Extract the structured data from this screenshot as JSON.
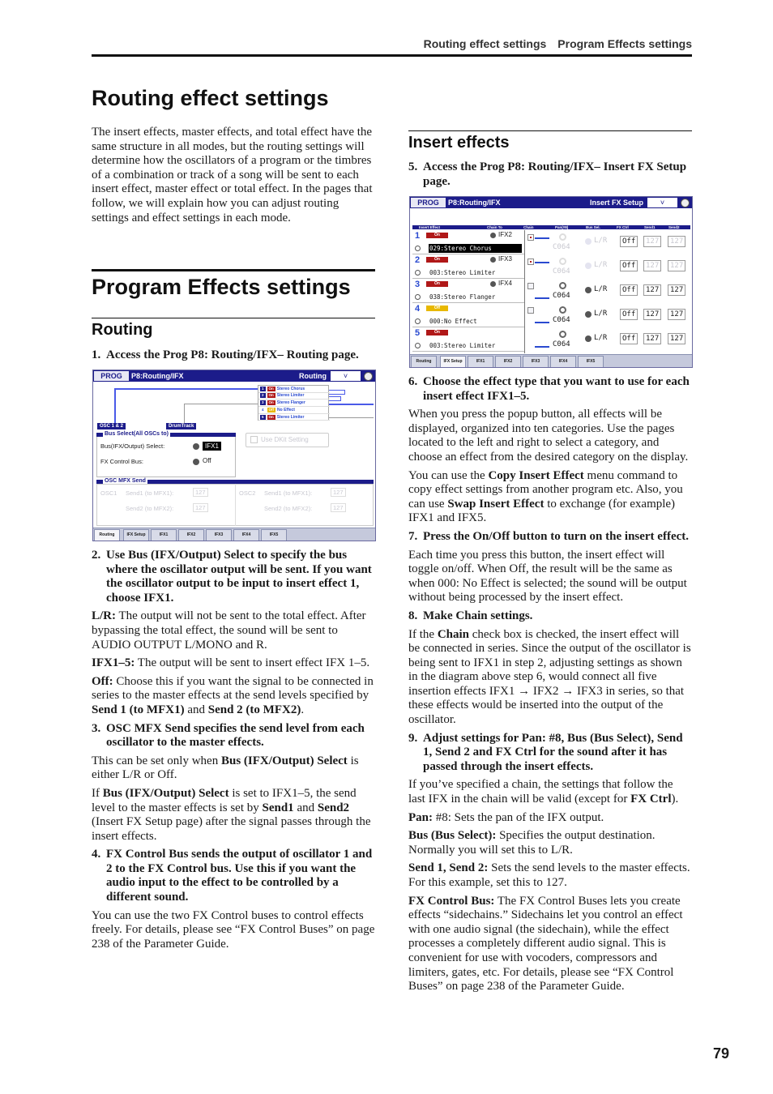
{
  "running_head": {
    "left": "Routing effect settings",
    "right": "Program Effects settings"
  },
  "page_number": "79",
  "sec1": {
    "title": "Routing effect settings",
    "intro": [
      {
        "t": "The insert effects, master effects, and total effect have the same structure in all modes, but the routing settings will determine how the oscillators of a program or the timbres of a combination or track of a song will be sent to each insert effect, master effect or total effect. In the pages that follow, we will explain how you can adjust routing settings and effect settings in each mode."
      }
    ]
  },
  "sec2": {
    "title": "Program Effects settings",
    "sub": "Routing"
  },
  "left_before": [
    {
      "type": "step",
      "num": "1.",
      "runs": [
        {
          "t": "Access the Prog P8: Routing/IFX– Routing page."
        }
      ]
    }
  ],
  "left_after": [
    {
      "type": "step",
      "num": "2.",
      "runs": [
        {
          "t": "Use Bus (IFX/Output) Select to specify the bus where the oscillator output will be sent. If you want the oscillator output to be input to insert effect 1, choose IFX1."
        }
      ]
    },
    {
      "type": "p",
      "runs": [
        {
          "t": "L/R:",
          "b": true
        },
        {
          "t": " The output will not be sent to the total effect. After bypassing the total effect, the sound will be sent to AUDIO OUTPUT L/MONO and R."
        }
      ]
    },
    {
      "type": "p",
      "runs": [
        {
          "t": "IFX1–5:",
          "b": true
        },
        {
          "t": " The output will be sent to insert effect IFX 1–5."
        }
      ]
    },
    {
      "type": "p",
      "runs": [
        {
          "t": "Off:",
          "b": true
        },
        {
          "t": " Choose this if you want the signal to be connected in series to the master effects at the send levels specified by "
        },
        {
          "t": "Send 1 (to MFX1)",
          "b": true
        },
        {
          "t": " and "
        },
        {
          "t": "Send 2 (to MFX2)",
          "b": true
        },
        {
          "t": "."
        }
      ]
    },
    {
      "type": "step",
      "num": "3.",
      "runs": [
        {
          "t": "OSC MFX Send specifies the send level from each oscillator to the master effects."
        }
      ]
    },
    {
      "type": "p",
      "runs": [
        {
          "t": "This can be set only when "
        },
        {
          "t": "Bus (IFX/Output) Select",
          "b": true
        },
        {
          "t": " is either L/R or Off."
        }
      ]
    },
    {
      "type": "p",
      "runs": [
        {
          "t": "If "
        },
        {
          "t": "Bus (IFX/Output) Select",
          "b": true
        },
        {
          "t": " is set to IFX1–5, the send level to the master effects is set by "
        },
        {
          "t": "Send1",
          "b": true
        },
        {
          "t": " and "
        },
        {
          "t": "Send2",
          "b": true
        },
        {
          "t": " (Insert FX Setup page) after the signal passes through the insert effects."
        }
      ]
    },
    {
      "type": "step",
      "num": "4.",
      "runs": [
        {
          "t": "FX Control Bus sends the output of oscillator 1 and 2 to the FX Control bus. Use this if you want the audio input to the effect to be controlled by a different sound."
        }
      ]
    },
    {
      "type": "p",
      "runs": [
        {
          "t": "You can use the two FX Control buses to control effects freely. For details, please see “FX Control Buses” on page 238 of the Parameter Guide."
        }
      ]
    }
  ],
  "sec3": {
    "title": "Insert effects"
  },
  "right_before": [
    {
      "type": "step",
      "num": "5.",
      "runs": [
        {
          "t": "Access the Prog P8: Routing/IFX– Insert FX Setup page."
        }
      ]
    }
  ],
  "right_after": [
    {
      "type": "step",
      "num": "6.",
      "runs": [
        {
          "t": "Choose the effect type that you want to use for each insert effect IFX1–5."
        }
      ]
    },
    {
      "type": "p",
      "runs": [
        {
          "t": "When you press the popup button, all effects will be displayed, organized into ten categories. Use the pages located to the left and right to select a category, and choose an effect from the desired category on the display."
        }
      ]
    },
    {
      "type": "p",
      "runs": [
        {
          "t": "You can use the "
        },
        {
          "t": "Copy Insert Effect",
          "b": true
        },
        {
          "t": " menu command to copy effect settings from another program etc. Also, you can use "
        },
        {
          "t": "Swap Insert Effect",
          "b": true
        },
        {
          "t": " to exchange (for example) IFX1 and IFX5."
        }
      ]
    },
    {
      "type": "step",
      "num": "7.",
      "runs": [
        {
          "t": "Press the On/Off button to turn on the insert effect."
        }
      ]
    },
    {
      "type": "p",
      "runs": [
        {
          "t": "Each time you press this button, the insert effect will toggle on/off. When Off, the result will be the same as when 000: No Effect is selected; the sound will be output without being processed by the insert effect."
        }
      ]
    },
    {
      "type": "step",
      "num": "8.",
      "runs": [
        {
          "t": "Make Chain settings."
        }
      ]
    },
    {
      "type": "p",
      "runs": [
        {
          "t": "If the "
        },
        {
          "t": "Chain",
          "b": true
        },
        {
          "t": " check box is checked, the insert effect will be connected in series. Since the output of the oscillator is being sent to IFX1 in step 2, adjusting settings as shown in the diagram above step 6, would connect all five insertion effects IFX1 → IFX2 → IFX3 in series, so that these effects would be inserted into the output of the oscillator."
        }
      ]
    },
    {
      "type": "step",
      "num": "9.",
      "runs": [
        {
          "t": "Adjust settings for Pan: #8, Bus (Bus Select), Send 1, Send 2 and FX Ctrl for the sound after it has passed through the insert effects."
        }
      ]
    },
    {
      "type": "p",
      "runs": [
        {
          "t": "If you’ve specified a chain, the settings that follow the last IFX in the chain will be valid (except for "
        },
        {
          "t": "FX Ctrl",
          "b": true
        },
        {
          "t": ")."
        }
      ]
    },
    {
      "type": "p",
      "runs": [
        {
          "t": "Pan:",
          "b": true
        },
        {
          "t": " #8: Sets the pan of the IFX output."
        }
      ]
    },
    {
      "type": "p",
      "runs": [
        {
          "t": "Bus (Bus Select):",
          "b": true
        },
        {
          "t": " Specifies the output destination. Normally you will set this to L/R."
        }
      ]
    },
    {
      "type": "p",
      "runs": [
        {
          "t": "Send 1, Send 2:",
          "b": true
        },
        {
          "t": " Sets the send levels to the master effects. For this example, set this to 127."
        }
      ]
    },
    {
      "type": "p",
      "runs": [
        {
          "t": "FX Control Bus:",
          "b": true
        },
        {
          "t": " The FX Control Buses lets you create effects “sidechains.” Sidechains let you control an effect with one audio signal (the sidechain), while the effect processes a completely different audio signal. This is convenient for use with vocoders, compressors and limiters, gates, etc. For details, please see “FX Control Buses” on page 238 of the Parameter Guide."
        }
      ]
    }
  ],
  "fig1": {
    "mode": "PROG",
    "page": "P8:Routing/IFX",
    "tab_title": "Routing",
    "dropdown": "˅",
    "effects": [
      {
        "num": "1",
        "state": "On",
        "name": "Stereo Chorus"
      },
      {
        "num": "2",
        "state": "On",
        "name": "Stereo Limiter"
      },
      {
        "num": "3",
        "state": "On",
        "name": "Stereo Flanger"
      },
      {
        "num": "4",
        "state": "Off",
        "name": "No Effect"
      },
      {
        "num": "5",
        "state": "On",
        "name": "Stereo Limiter"
      }
    ],
    "osc_label": "OSC 1 & 2",
    "drum_label": "DrumTrack",
    "bus_header": "Bus Select(All OSCs to)",
    "bus_select_label": "Bus(IFX/Output) Select:",
    "bus_select_value": "IFX1",
    "fx_bus_label": "FX Control Bus:",
    "fx_bus_value": "Off",
    "dkit_label": "Use DKit Setting",
    "mfx_header": "OSC MFX Send",
    "osc1": "OSC1",
    "osc2": "OSC2",
    "send1_label": "Send1 (to MFX1):",
    "send2_label": "Send2 (to MFX2):",
    "send_value": "127",
    "tabs": [
      "Routing",
      "IFX Setup",
      "IFX1",
      "IFX2",
      "IFX3",
      "IFX4",
      "IFX5"
    ]
  },
  "fig2": {
    "mode": "PROG",
    "page": "P8:Routing/IFX",
    "tab_title": "Insert FX Setup",
    "dropdown": "˅",
    "headers": [
      "Insert Effect",
      "Chain To",
      "Chain",
      "Pan(#8)",
      "Bus Sel.",
      "FX Ctrl",
      "Send1",
      "Send2"
    ],
    "rows": [
      {
        "num": "1",
        "state": "On",
        "chain_to": "IFX2",
        "effect": "029:Stereo Chorus",
        "chain": true,
        "pan": "C064",
        "bus": "L/R",
        "fx_ctrl": "Off",
        "send1": "127",
        "send2": "127",
        "dim": true
      },
      {
        "num": "2",
        "state": "On",
        "chain_to": "IFX3",
        "effect": "003:Stereo Limiter",
        "chain": true,
        "pan": "C064",
        "bus": "L/R",
        "fx_ctrl": "Off",
        "send1": "127",
        "send2": "127",
        "dim": true
      },
      {
        "num": "3",
        "state": "On",
        "chain_to": "IFX4",
        "effect": "038:Stereo Flanger",
        "chain": false,
        "pan": "C064",
        "bus": "L/R",
        "fx_ctrl": "Off",
        "send1": "127",
        "send2": "127",
        "dim": false
      },
      {
        "num": "4",
        "state": "Off",
        "chain_to": "",
        "effect": "000:No Effect",
        "chain": false,
        "pan": "C064",
        "bus": "L/R",
        "fx_ctrl": "Off",
        "send1": "127",
        "send2": "127",
        "dim": false
      },
      {
        "num": "5",
        "state": "On",
        "chain_to": "",
        "effect": "003:Stereo Limiter",
        "chain": null,
        "pan": "C064",
        "bus": "L/R",
        "fx_ctrl": "Off",
        "send1": "127",
        "send2": "127",
        "dim": false
      }
    ],
    "tabs": [
      "Routing",
      "IFX Setup",
      "IFX1",
      "IFX2",
      "IFX3",
      "IFX4",
      "IFX5"
    ]
  },
  "colors": {
    "navy": "#1c1c8a",
    "on": "#b01818",
    "off": "#e8b800",
    "accent": "#2a4ad0"
  }
}
